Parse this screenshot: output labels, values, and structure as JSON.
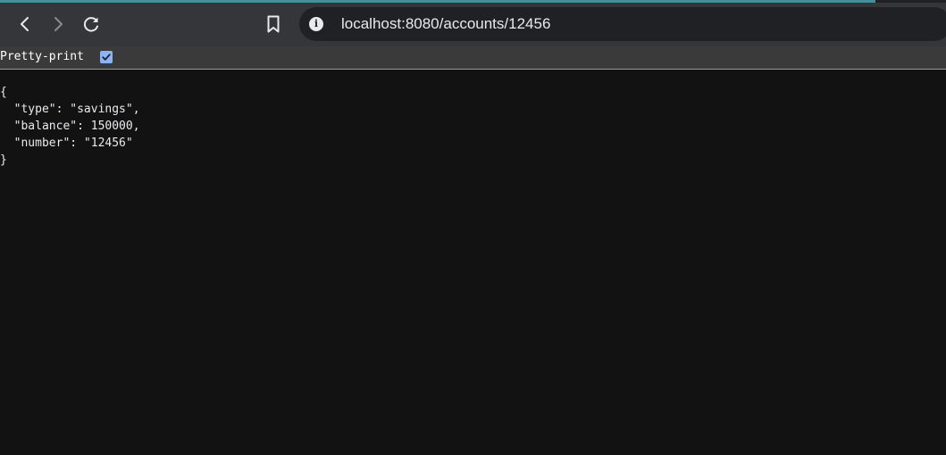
{
  "page_load_progress": 0.925,
  "browser": {
    "nav": {
      "back_icon": "chevron-left-icon",
      "forward_icon": "chevron-right-icon",
      "reload_icon": "reload-icon",
      "bookmark_icon": "bookmark-icon",
      "site_info_icon": "info-icon"
    },
    "url": "localhost:8080/accounts/12456"
  },
  "viewer": {
    "pretty_print_label": "Pretty-print",
    "pretty_print_checked": true
  },
  "json_body": "{\n  \"type\": \"savings\",\n  \"balance\": 150000,\n  \"number\": \"12456\"\n}",
  "colors": {
    "toolbar": "#35363a",
    "omnibox": "#202124",
    "page_background": "#121212",
    "checkbox_accent": "#8ab4f8",
    "progress": "#4a8f96"
  }
}
